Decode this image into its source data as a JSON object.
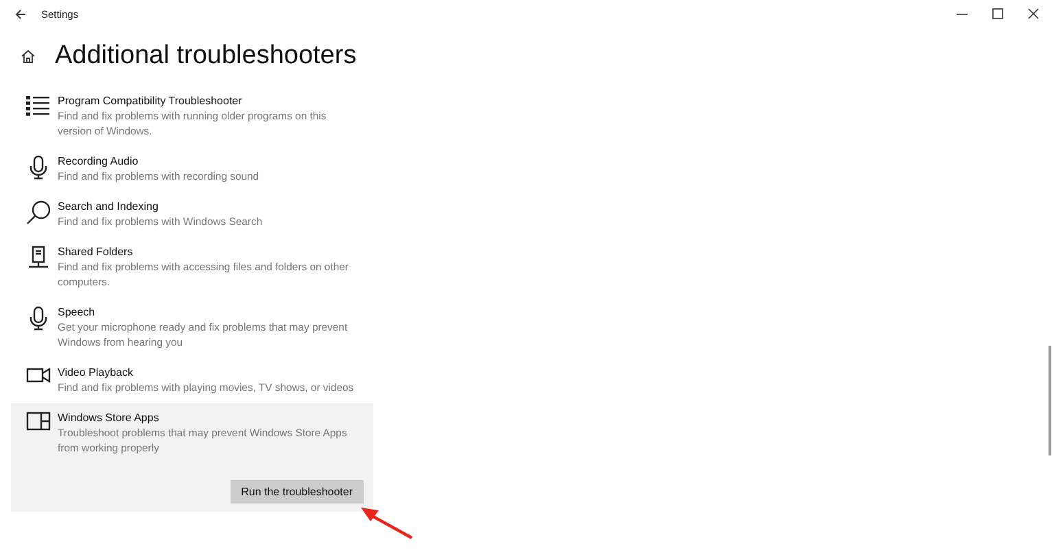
{
  "window": {
    "title": "Settings"
  },
  "page": {
    "title": "Additional troubleshooters"
  },
  "items": [
    {
      "kind": "list",
      "title": "Program Compatibility Troubleshooter",
      "description": "Find and fix problems with running older programs on this version of Windows.",
      "selected": false
    },
    {
      "kind": "microphone",
      "title": "Recording Audio",
      "description": "Find and fix problems with recording sound",
      "selected": false
    },
    {
      "kind": "search",
      "title": "Search and Indexing",
      "description": "Find and fix problems with Windows Search",
      "selected": false
    },
    {
      "kind": "network",
      "title": "Shared Folders",
      "description": "Find and fix problems with accessing files and folders on other computers.",
      "selected": false
    },
    {
      "kind": "microphone",
      "title": "Speech",
      "description": "Get your microphone ready and fix problems that may prevent Windows from hearing you",
      "selected": false
    },
    {
      "kind": "camera",
      "title": "Video Playback",
      "description": "Find and fix problems with playing movies, TV shows, or videos",
      "selected": false
    },
    {
      "kind": "app",
      "title": "Windows Store Apps",
      "description": "Troubleshoot problems that may prevent Windows Store Apps from working properly",
      "selected": true,
      "button": "Run the troubleshooter"
    }
  ]
}
